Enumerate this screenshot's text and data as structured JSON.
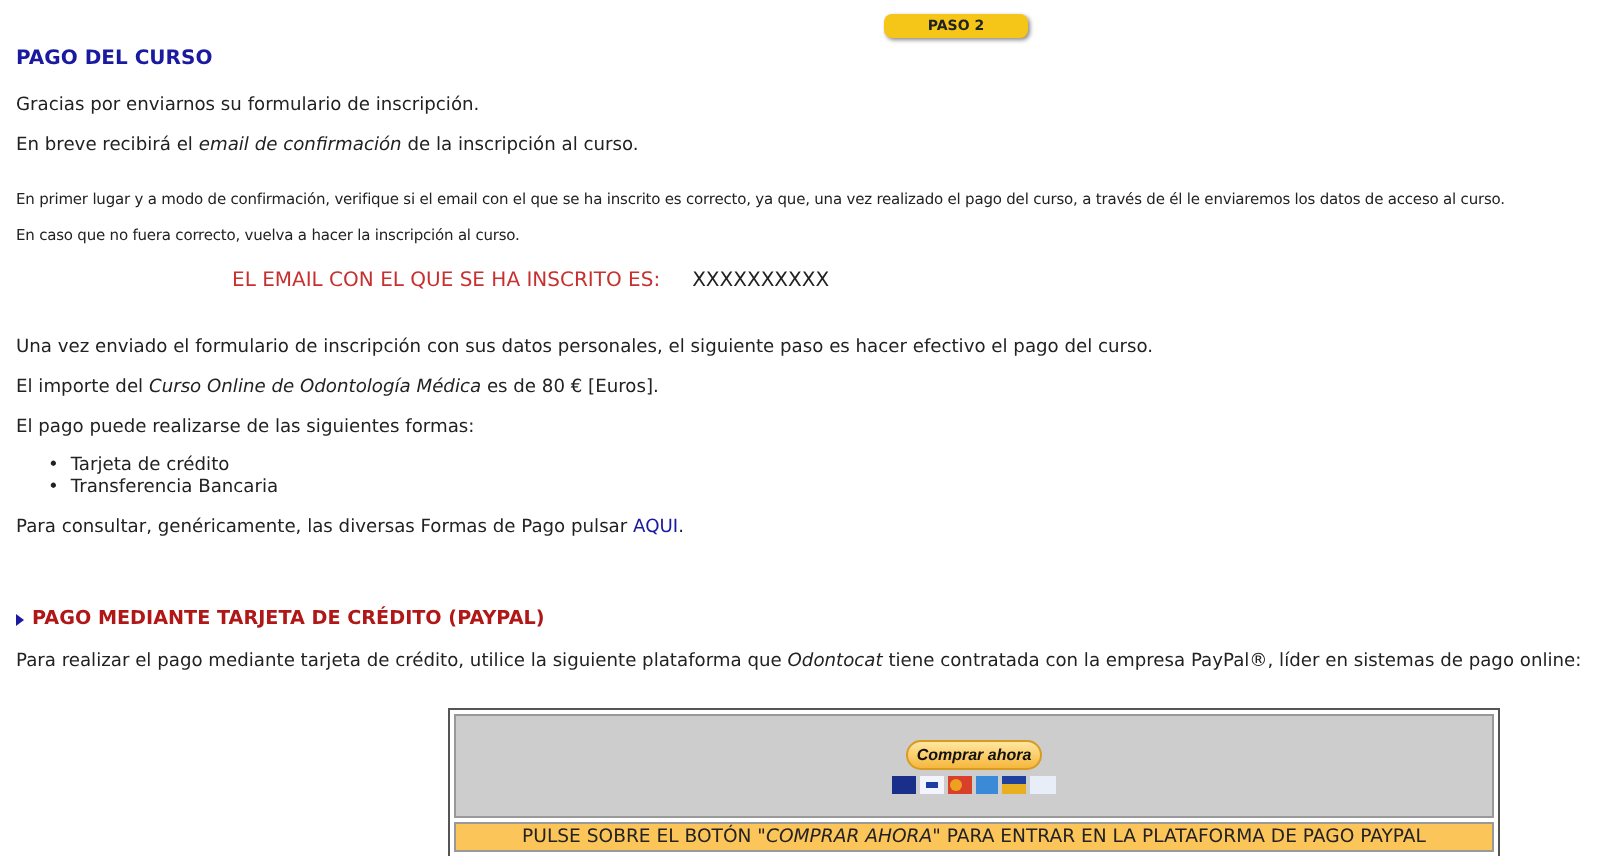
{
  "step_badge": "PASO 2",
  "heading": "PAGO DEL CURSO",
  "intro": [
    "Gracias por enviarnos su formulario de inscripción.",
    "En breve recibirá el *email de confirmación* de la inscripción al curso."
  ],
  "notes": [
    "En primer lugar y a modo de confirmación, verifique si el email con el que se ha inscrito es correcto, ya que, una vez realizado el pago del curso, a través de él le enviaremos los datos de acceso al curso.",
    "En caso que no fuera correcto, vuelva a hacer la inscripción al curso."
  ],
  "email": {
    "label": "EL EMAIL CON EL QUE SE HA INSCRITO ES:",
    "value": "XXXXXXXXXX"
  },
  "body": [
    "Una vez enviado el formulario de inscripción con sus datos personales, el siguiente paso es hacer efectivo el pago del curso.",
    "El importe del *Curso Online de Odontología Médica* es de 80 € [Euros]."
  ],
  "methods": {
    "intro": "El pago puede realizarse de las siguientes formas:",
    "items": [
      {
        "bullet": "•",
        "text": "Tarjeta de crédito"
      },
      {
        "bullet": "•",
        "text": "Transferencia Bancaria"
      }
    ]
  },
  "consult": {
    "text": "Para consultar, genéricamente, las diversas Formas de Pago pulsar",
    "link": "AQUI",
    "after": "."
  },
  "paypal": {
    "title": "PAGO MEDIANTE TARJETA DE CRÉDITO (PAYPAL)",
    "text": "Para realizar el pago mediante tarjeta de crédito, utilice la siguiente plataforma que *Odontocat* tiene contratada con la empresa PayPal®, líder en sistemas de pago online:",
    "button": "Comprar ahora",
    "footer": "PULSE SOBRE EL BOTÓN \"*COMPRAR AHORA*\" PARA ENTRAR EN LA PLATAFORMA DE PAGO PAYPAL"
  }
}
